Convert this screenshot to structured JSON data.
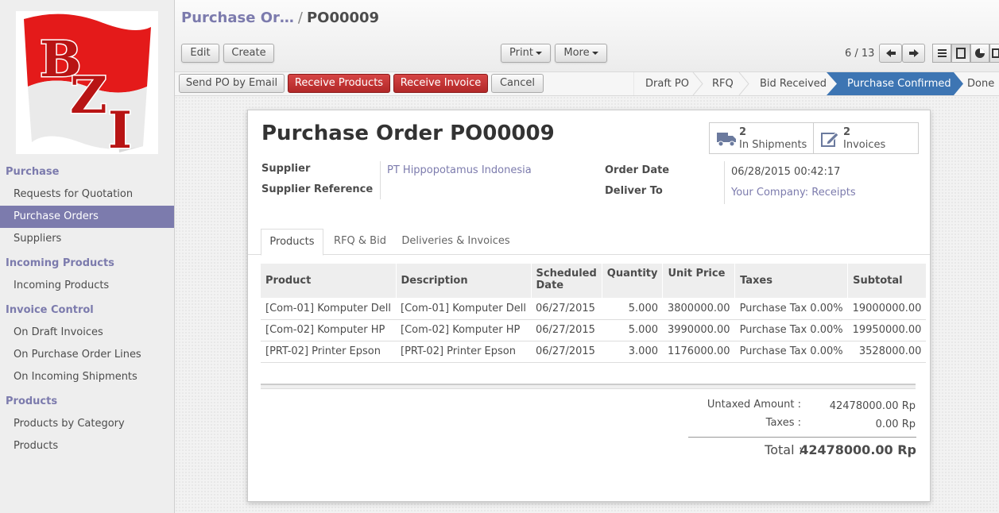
{
  "sidebar": {
    "logo_text": "BZI",
    "sections": [
      {
        "title": "Purchase",
        "items": [
          "Requests for Quotation",
          "Purchase Orders",
          "Suppliers"
        ]
      },
      {
        "title": "Incoming Products",
        "items": [
          "Incoming Products"
        ]
      },
      {
        "title": "Invoice Control",
        "items": [
          "On Draft Invoices",
          "On Purchase Order Lines",
          "On Incoming Shipments"
        ]
      },
      {
        "title": "Products",
        "items": [
          "Products by Category",
          "Products"
        ]
      }
    ],
    "active_item": "Purchase Orders"
  },
  "header": {
    "breadcrumb_parent": "Purchase Or…",
    "breadcrumb_sep": "/",
    "breadcrumb_current": "PO00009",
    "edit_label": "Edit",
    "create_label": "Create",
    "print_label": "Print",
    "more_label": "More",
    "pager": "6 / 13"
  },
  "statusbar": {
    "send_po_label": "Send PO by Email",
    "receive_products_label": "Receive Products",
    "receive_invoice_label": "Receive Invoice",
    "cancel_label": "Cancel",
    "stages": [
      "Draft PO",
      "RFQ",
      "Bid Received",
      "Purchase Confirmed",
      "Done"
    ],
    "active_stage": "Purchase Confirmed"
  },
  "form": {
    "title_prefix": "Purchase Order",
    "title_number": "PO00009",
    "shipments_count": "2",
    "shipments_label": "In Shipments",
    "invoices_count": "2",
    "invoices_label": "Invoices",
    "supplier_label": "Supplier",
    "supplier_value": "PT Hippopotamus Indonesia",
    "supplier_ref_label": "Supplier Reference",
    "order_date_label": "Order Date",
    "order_date_value": "06/28/2015 00:42:17",
    "deliver_to_label": "Deliver To",
    "deliver_to_value": "Your Company: Receipts"
  },
  "tabs": [
    "Products",
    "RFQ & Bid",
    "Deliveries & Invoices"
  ],
  "table": {
    "headers": [
      "Product",
      "Description",
      "Scheduled Date",
      "Quantity",
      "Unit Price",
      "Taxes",
      "Subtotal"
    ],
    "rows": [
      [
        "[Com-01] Komputer Dell",
        "[Com-01] Komputer Dell",
        "06/27/2015",
        "5.000",
        "3800000.00",
        "Purchase Tax 0.00%",
        "19000000.00"
      ],
      [
        "[Com-02] Komputer HP",
        "[Com-02] Komputer HP",
        "06/27/2015",
        "5.000",
        "3990000.00",
        "Purchase Tax 0.00%",
        "19950000.00"
      ],
      [
        "[PRT-02] Printer Epson",
        "[PRT-02] Printer Epson",
        "06/27/2015",
        "3.000",
        "1176000.00",
        "Purchase Tax 0.00%",
        "3528000.00"
      ]
    ]
  },
  "totals": {
    "untaxed_label": "Untaxed Amount :",
    "untaxed_value": "42478000.00 Rp",
    "taxes_label": "Taxes :",
    "taxes_value": "0.00 Rp",
    "total_label": "Total :",
    "total_value": "42478000.00 Rp"
  },
  "colors": {
    "accent": "#7c7bad",
    "stage_active": "#3d75b3",
    "red_button": "#c03030"
  }
}
